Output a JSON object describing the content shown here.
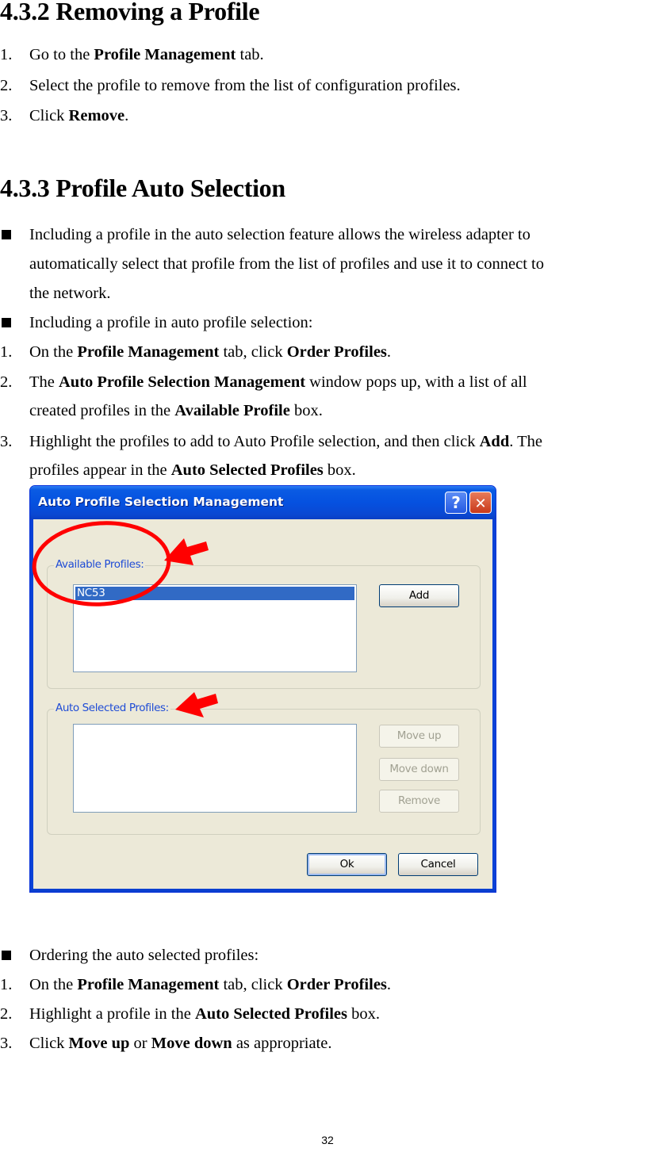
{
  "section_432": {
    "heading": "4.3.2 Removing a Profile",
    "steps": [
      {
        "num": "1.",
        "pre": "Go to the ",
        "bold": "Profile Management",
        "post": " tab."
      },
      {
        "num": "2.",
        "text": "Select the profile to remove from the list of configuration profiles."
      },
      {
        "num": "3.",
        "pre": "Click ",
        "bold": "Remove",
        "post": "."
      }
    ]
  },
  "section_433": {
    "heading": "4.3.3 Profile Auto Selection",
    "bullet1": {
      "lines": [
        "Including a profile in the auto selection feature allows the wireless adapter to",
        "automatically select that profile from the list of profiles and use it to connect to",
        "the network."
      ]
    },
    "bullet2": "Including a profile in auto profile selection:",
    "include_steps": [
      {
        "num": "1.",
        "pre": "On the ",
        "bold1": "Profile Management",
        "mid": " tab, click ",
        "bold2": "Order Profiles",
        "post": "."
      },
      {
        "num": "2.",
        "pre": "The ",
        "bold1": "Auto Profile Selection Management",
        "mid": " window pops up, with a list of all",
        "line2_pre": "created profiles in the ",
        "bold2": "Available Profile",
        "post": " box."
      },
      {
        "num": "3.",
        "pre": "Highlight the profiles to add to Auto Profile selection, and then click ",
        "bold1": "Add",
        "mid": ". The",
        "line2_pre": "profiles appear in the ",
        "bold2": "Auto Selected Profiles",
        "post": " box."
      }
    ],
    "bullet3": "Ordering the auto selected profiles:",
    "order_steps": [
      {
        "num": "1.",
        "pre": "On the ",
        "bold1": "Profile Management",
        "mid": " tab, click ",
        "bold2": "Order Profiles",
        "post": "."
      },
      {
        "num": "2.",
        "pre": "Highlight a profile in the ",
        "bold1": "Auto Selected Profiles",
        "post": " box."
      },
      {
        "num": "3.",
        "pre": "Click ",
        "bold1": "Move up",
        "mid": " or ",
        "bold2": "Move down",
        "post": " as appropriate."
      }
    ]
  },
  "dialog": {
    "title": "Auto Profile Selection Management",
    "help_glyph": "?",
    "close_glyph": "✕",
    "available_label": "Available Profiles:",
    "available_items": [
      "NC53"
    ],
    "add_label": "Add",
    "auto_selected_label": "Auto Selected Profiles:",
    "auto_selected_items": [],
    "move_up_label": "Move up",
    "move_down_label": "Move down",
    "remove_label": "Remove",
    "ok_label": "Ok",
    "cancel_label": "Cancel",
    "colors": {
      "titlebar": "#0551e0",
      "face": "#ece9d8",
      "group_label": "#1f4cd6",
      "selection": "#316ac5",
      "annotation": "#ff0000"
    }
  },
  "footer": {
    "page_number": "32"
  }
}
